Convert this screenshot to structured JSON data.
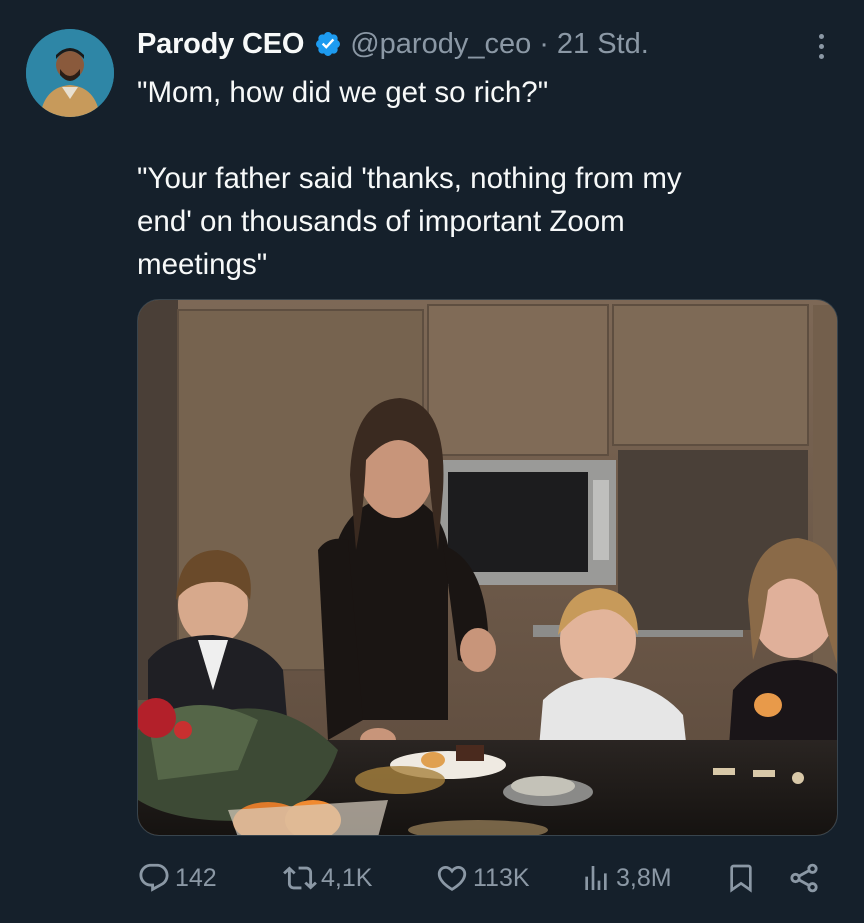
{
  "tweet": {
    "author": {
      "display_name": "Parody CEO",
      "handle": "@parody_ceo",
      "separator": "·",
      "time": "21 Std.",
      "verified": true,
      "avatar_icon": "avatar-photo"
    },
    "text_lines": [
      "\"Mom, how did we get so rich?\"",
      "\"Your father said 'thanks, nothing from my",
      "end' on thousands of important Zoom",
      "meetings\""
    ],
    "media": {
      "type": "photo"
    },
    "actions": {
      "replies": "142",
      "retweets": "4,1K",
      "likes": "113K",
      "views": "3,8M"
    }
  },
  "colors": {
    "background": "#15202b",
    "text": "#f7f9f9",
    "secondary_text": "#8b98a5",
    "verified_badge": "#1d9bf0"
  },
  "icons": {
    "more": "more-dots-icon",
    "verified": "verified-badge-icon",
    "reply": "reply-icon",
    "retweet": "retweet-icon",
    "like": "heart-icon",
    "views": "views-bar-chart-icon",
    "bookmark": "bookmark-icon",
    "share": "share-icon"
  }
}
